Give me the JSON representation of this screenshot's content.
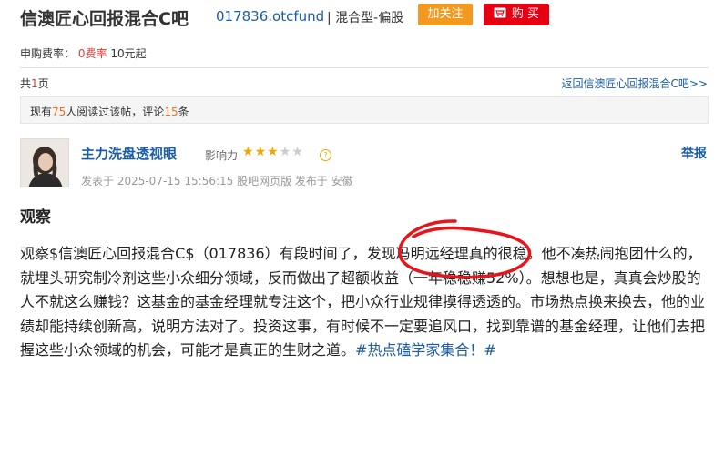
{
  "header": {
    "fund_name": "信澳匠心回报混合C吧",
    "fund_code": "017836.otcfund",
    "fund_type": "| 混合型-偏股",
    "follow_label": "加关注",
    "buy_label": "购 买"
  },
  "fee": {
    "label": "申购费率：",
    "rate": "0费率",
    "minimum": "10元起"
  },
  "pager": {
    "prefix": "共",
    "count": "1",
    "suffix": "页",
    "back_link": "返回信澳匠心回报混合C吧>>"
  },
  "stats": {
    "text1": "现有",
    "readers": "75",
    "text2": "人阅读过该帖，评论",
    "comments": "15",
    "text3": "条"
  },
  "author": {
    "name": "主力洗盘透视眼",
    "influence_label": "影响力",
    "rating": 3,
    "rating_max": 5,
    "report_label": "举报",
    "meta": "发表于 2025-07-15 15:56:15 股吧网页版 发布于 安徽"
  },
  "post": {
    "title": "观察",
    "body": "观察$信澳匠心回报混合C$（017836）有段时间了，发现冯明远经理真的很稳。他不凑热闹抱团什么的，就埋头研究制冷剂这些小众细分领域，反而做出了超额收益（一年稳稳赚52%）。想想也是，真真会炒股的人不就这么赚钱？这基金的基金经理就专注这个，把小众行业规律摸得透透的。市场热点换来换去，他的业绩却能持续创新高，说明方法对了。投资这事，有时候不一定要追风口，找到靠谱的基金经理，让他们去把握这些小众领域的机会，可能才是真正的生财之道。",
    "hashtag": "#热点磕学家集合！#"
  },
  "colors": {
    "link_blue": "#1a5da6",
    "follow_orange": "#f39a1e",
    "buy_red": "#e60012",
    "annotation_red": "#e8141c"
  },
  "icons": {
    "cart": "cart-icon",
    "star": "star-icon",
    "help": "question-icon"
  }
}
